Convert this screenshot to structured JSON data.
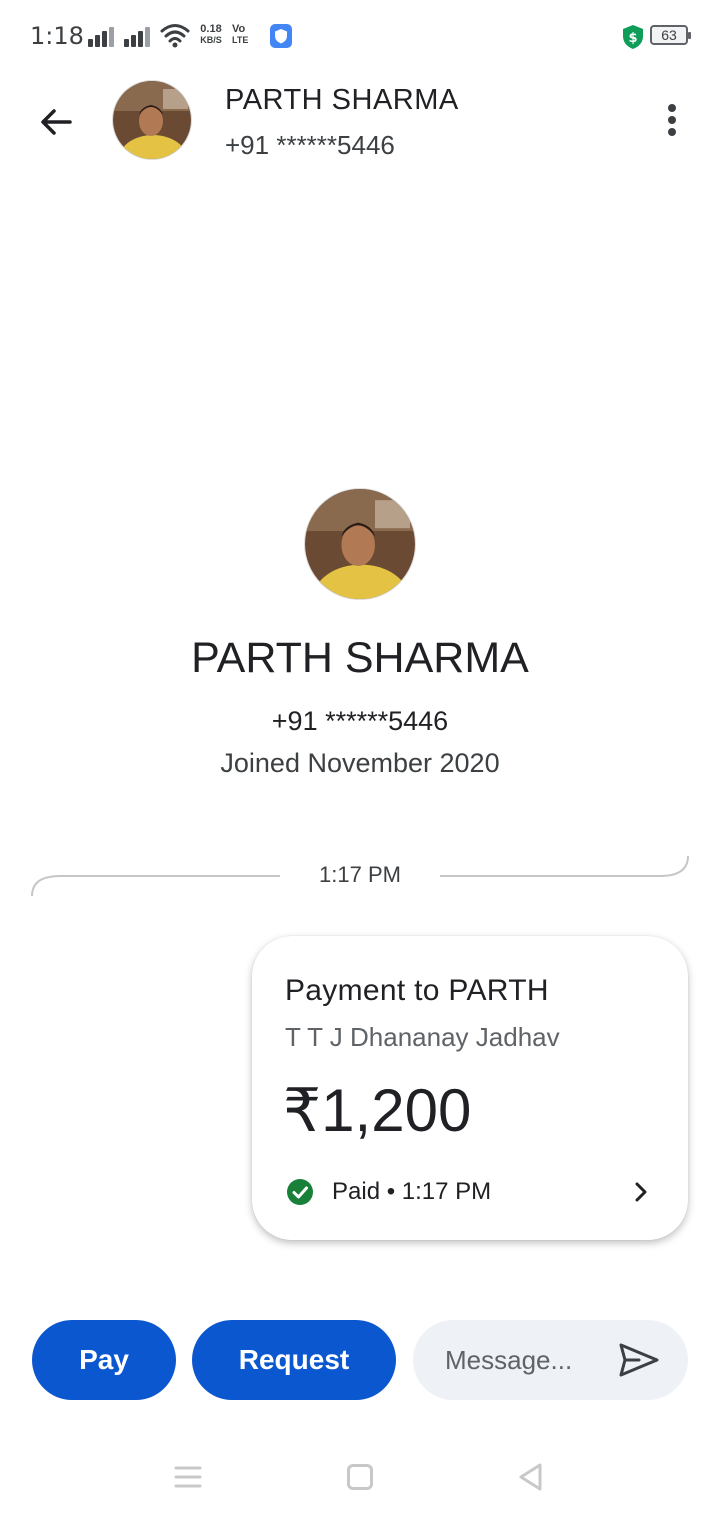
{
  "status_bar": {
    "time": "1:18",
    "net_speed_value": "0.18",
    "net_speed_unit": "KB/S",
    "volte_top": "Vo",
    "volte_bottom": "LTE",
    "battery": "63",
    "icons": [
      "signal-icon",
      "signal-icon",
      "wifi-icon",
      "app-shield-icon",
      "security-shield-icon",
      "battery-icon"
    ]
  },
  "header": {
    "name": "PARTH SHARMA",
    "phone": "+91 ******5446",
    "icons": [
      "back-arrow-icon",
      "more-vert-icon"
    ]
  },
  "profile": {
    "name": "PARTH SHARMA",
    "phone": "+91 ******5446",
    "joined": "Joined November 2020"
  },
  "timeline": {
    "time": "1:17 PM"
  },
  "payment_card": {
    "title": "Payment to PARTH",
    "subtitle": "T T J Dhananay Jadhav",
    "amount": "₹1,200",
    "status": "Paid • 1:17 PM",
    "icons": [
      "check-circle-icon",
      "chevron-right-icon"
    ]
  },
  "actions": {
    "pay_label": "Pay",
    "request_label": "Request",
    "message_placeholder": "Message..."
  },
  "colors": {
    "primary": "#0b57d0",
    "success": "#188038",
    "text": "#202124",
    "secondary_text": "#5f6368",
    "input_bg": "#eef1f6"
  }
}
